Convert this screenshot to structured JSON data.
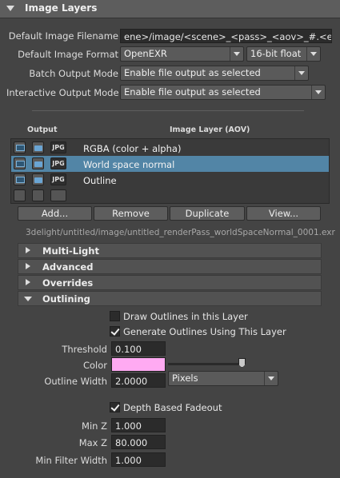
{
  "header": {
    "title": "Image Layers"
  },
  "settings": {
    "filename_label": "Default Image Filename",
    "filename_value": "ene>/image/<scene>_<pass>_<aov>_#.<ext>",
    "format_label": "Default Image Format",
    "format_value": "OpenEXR",
    "depth_value": "16-bit float",
    "batch_label": "Batch Output Mode",
    "batch_value": "Enable file output as selected",
    "interactive_label": "Interactive Output Mode",
    "interactive_value": "Enable file output as selected"
  },
  "table": {
    "col_output": "Output",
    "col_layer": "Image Layer (AOV)",
    "rows": [
      {
        "label": "RGBA (color + alpha)",
        "format": "JPG",
        "selected": false
      },
      {
        "label": "World space normal",
        "format": "JPG",
        "selected": true
      },
      {
        "label": "Outline",
        "format": "JPG",
        "selected": false
      }
    ]
  },
  "buttons": {
    "add": "Add...",
    "remove": "Remove",
    "duplicate": "Duplicate",
    "view": "View..."
  },
  "output_path": "3delight/untitled/image/untitled_renderPass_worldSpaceNormal_0001.exr",
  "sections": {
    "multi_light": "Multi-Light",
    "advanced": "Advanced",
    "overrides": "Overrides",
    "outlining": "Outlining"
  },
  "outlining": {
    "draw_label": "Draw Outlines in this Layer",
    "draw_checked": false,
    "generate_label": "Generate Outlines Using This Layer",
    "generate_checked": true,
    "threshold_label": "Threshold",
    "threshold_value": "0.100",
    "color_label": "Color",
    "color_hex": "#ffaaf2",
    "width_label": "Outline Width",
    "width_value": "2.0000",
    "width_unit": "Pixels",
    "depth_fade_label": "Depth Based Fadeout",
    "depth_fade_checked": true,
    "minz_label": "Min Z",
    "minz_value": "1.000",
    "maxz_label": "Max Z",
    "maxz_value": "80.000",
    "minfilter_label": "Min Filter Width",
    "minfilter_value": "1.000"
  },
  "colors": {
    "selection": "#5285a6",
    "panel": "#444444"
  }
}
